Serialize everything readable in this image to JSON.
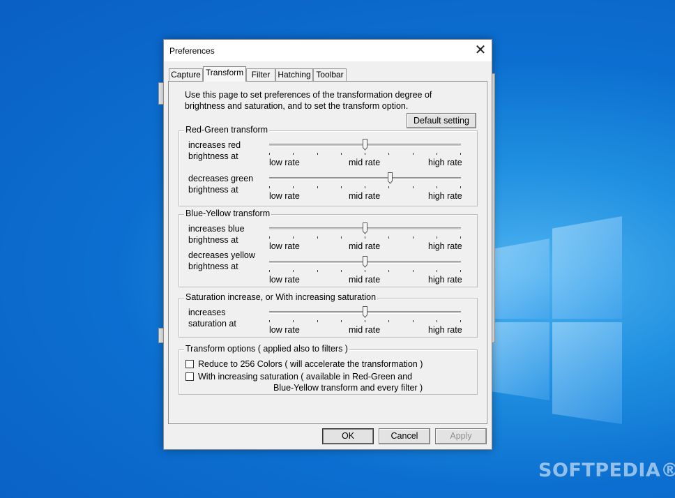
{
  "desktop": {
    "watermark": "SOFTPEDIA®"
  },
  "dialog": {
    "title": "Preferences",
    "close_glyph": "✕",
    "tabs": [
      {
        "label": "Capture"
      },
      {
        "label": "Transform",
        "active": true
      },
      {
        "label": "Filter"
      },
      {
        "label": "Hatching"
      },
      {
        "label": "Toolbar"
      }
    ],
    "intro": "Use this page to set preferences of the transformation degree of brightness and saturation, and to set the transform option.",
    "default_button": "Default setting",
    "slider_labels": {
      "low": "low rate",
      "mid": "mid rate",
      "high": "high rate"
    },
    "groups": {
      "red_green": {
        "title": "Red-Green transform",
        "rows": [
          {
            "label": "increases red brightness at",
            "value": 0.5
          },
          {
            "label": "decreases green brightness at",
            "value": 0.63
          }
        ]
      },
      "blue_yellow": {
        "title": "Blue-Yellow transform",
        "rows": [
          {
            "label": "increases blue brightness at",
            "value": 0.5
          },
          {
            "label": "decreases yellow brightness at",
            "value": 0.5
          }
        ]
      },
      "saturation": {
        "title": "Saturation increase, or With increasing saturation",
        "rows": [
          {
            "label": "increases saturation at",
            "value": 0.5
          }
        ]
      },
      "options": {
        "title": "Transform options ( applied also to filters )",
        "items": [
          {
            "label": "Reduce to 256 Colors ( will accelerate the transformation )",
            "checked": false
          },
          {
            "label": "With increasing saturation ( available in Red-Green and",
            "label_cont": "Blue-Yellow transform and every filter )",
            "checked": false
          }
        ]
      }
    },
    "buttons": {
      "ok": "OK",
      "cancel": "Cancel",
      "apply": "Apply"
    },
    "apply_enabled": false
  }
}
